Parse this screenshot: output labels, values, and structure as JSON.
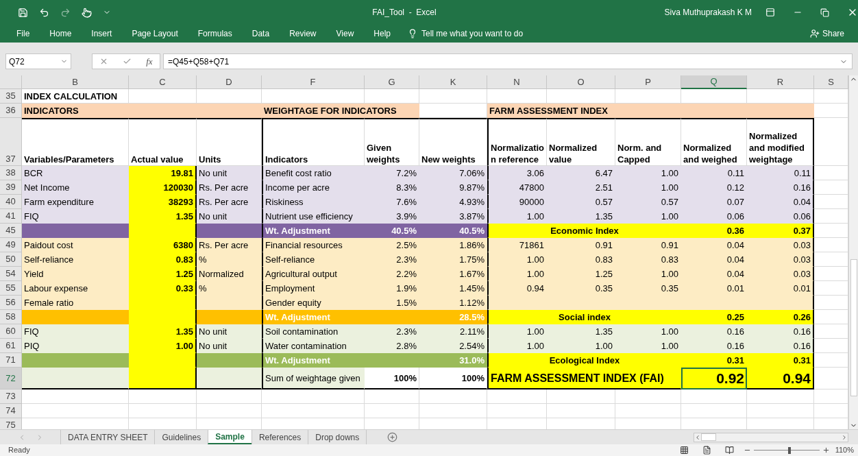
{
  "window": {
    "title": "FAI_Tool  -  Excel",
    "user": "Siva Muthuprakash K M"
  },
  "ribbon_tabs": [
    {
      "label": "File"
    },
    {
      "label": "Home"
    },
    {
      "label": "Insert"
    },
    {
      "label": "Page Layout"
    },
    {
      "label": "Formulas"
    },
    {
      "label": "Data"
    },
    {
      "label": "Review"
    },
    {
      "label": "View"
    },
    {
      "label": "Help"
    }
  ],
  "tell_me": "Tell me what you want to do",
  "share": "Share",
  "formula_bar": {
    "name_box": "Q72",
    "function_label": "fx",
    "formula": "=Q45+Q58+Q71"
  },
  "columns": [
    {
      "label": "B",
      "selected": false
    },
    {
      "label": "C",
      "selected": false
    },
    {
      "label": "D",
      "selected": false
    },
    {
      "label": "F",
      "selected": false
    },
    {
      "label": "G",
      "selected": false
    },
    {
      "label": "K",
      "selected": false
    },
    {
      "label": "N",
      "selected": false
    },
    {
      "label": "O",
      "selected": false
    },
    {
      "label": "P",
      "selected": false
    },
    {
      "label": "Q",
      "selected": true
    },
    {
      "label": "R",
      "selected": false
    },
    {
      "label": "S",
      "selected": false
    }
  ],
  "rows": [
    {
      "num": "35",
      "kind": "title",
      "selected": false,
      "cells": {
        "b": "INDEX CALCULATION"
      }
    },
    {
      "num": "36",
      "kind": "section_header",
      "selected": false,
      "cells": {
        "b": "INDICATORS",
        "f": "WEIGHTAGE FOR INDICATORS",
        "n": "FARM ASSESSMENT INDEX"
      }
    },
    {
      "num": "37",
      "kind": "column_header",
      "selected": false,
      "cells": {
        "b": "Variables/Parameters",
        "c": "Actual value",
        "d": "Units",
        "f": "Indicators",
        "g": "Given weights",
        "k": "New weights",
        "n": "Normalization reference",
        "o": "Normalized value",
        "p": "Norm. and Capped",
        "q": "Normalized and weighed",
        "r": "Normalized and modified weightage"
      }
    },
    {
      "num": "38",
      "kind": "economic",
      "selected": false,
      "cells": {
        "b": "BCR",
        "c": "19.81",
        "d": "No unit",
        "f": "Benefit cost ratio",
        "g": "7.2%",
        "k": "7.06%",
        "n": "3.06",
        "o": "6.47",
        "p": "1.00",
        "q": "0.11",
        "r": "0.11"
      }
    },
    {
      "num": "39",
      "kind": "economic",
      "selected": false,
      "cells": {
        "b": "Net Income",
        "c": "120030",
        "d": "Rs. Per acre",
        "f": "Income per acre",
        "g": "8.3%",
        "k": "9.87%",
        "n": "47800",
        "o": "2.51",
        "p": "1.00",
        "q": "0.12",
        "r": "0.16"
      }
    },
    {
      "num": "40",
      "kind": "economic",
      "selected": false,
      "cells": {
        "b": "Farm expenditure",
        "c": "38293",
        "d": "Rs. Per acre",
        "f": "Riskiness",
        "g": "7.6%",
        "k": "4.93%",
        "n": "90000",
        "o": "0.57",
        "p": "0.57",
        "q": "0.07",
        "r": "0.04"
      }
    },
    {
      "num": "41",
      "kind": "economic",
      "selected": false,
      "cells": {
        "b": "FIQ",
        "c": "1.35",
        "d": "No unit",
        "f": "Nutrient use efficiency",
        "g": "3.9%",
        "k": "3.87%",
        "n": "1.00",
        "o": "1.35",
        "p": "1.00",
        "q": "0.06",
        "r": "0.06"
      }
    },
    {
      "num": "45",
      "kind": "economic_total",
      "selected": false,
      "cells": {
        "f": "Wt. Adjustment",
        "g": "40.5%",
        "k": "40.5%",
        "n": "Economic Index",
        "q": "0.36",
        "r": "0.37"
      }
    },
    {
      "num": "49",
      "kind": "social",
      "selected": false,
      "cells": {
        "b": "Paidout cost",
        "c": "6380",
        "d": "Rs. Per acre",
        "f": "Financial resources",
        "g": "2.5%",
        "k": "1.86%",
        "n": "71861",
        "o": "0.91",
        "p": "0.91",
        "q": "0.04",
        "r": "0.03"
      }
    },
    {
      "num": "50",
      "kind": "social",
      "selected": false,
      "cells": {
        "b": "Self-reliance",
        "c": "0.83",
        "d": "%",
        "f": "Self-reliance",
        "g": "2.3%",
        "k": "1.75%",
        "n": "1.00",
        "o": "0.83",
        "p": "0.83",
        "q": "0.04",
        "r": "0.03"
      }
    },
    {
      "num": "54",
      "kind": "social",
      "selected": false,
      "cells": {
        "b": "Yield",
        "c": "1.25",
        "d": "Normalized",
        "f": "Agricultural output",
        "g": "2.2%",
        "k": "1.67%",
        "n": "1.00",
        "o": "1.25",
        "p": "1.00",
        "q": "0.04",
        "r": "0.03"
      }
    },
    {
      "num": "55",
      "kind": "social",
      "selected": false,
      "cells": {
        "b": "Labour expense",
        "c": "0.33",
        "d": "%",
        "f": "Employment",
        "g": "1.9%",
        "k": "1.45%",
        "n": "0.94",
        "o": "0.35",
        "p": "0.35",
        "q": "0.01",
        "r": "0.01"
      }
    },
    {
      "num": "56",
      "kind": "social",
      "selected": false,
      "cells": {
        "b": "Female ratio",
        "f": "Gender equity",
        "g": "1.5%",
        "k": "1.12%"
      }
    },
    {
      "num": "58",
      "kind": "social_total",
      "selected": false,
      "cells": {
        "f": "Wt. Adjustment",
        "k": "28.5%",
        "n": "Social index",
        "q": "0.25",
        "r": "0.26"
      }
    },
    {
      "num": "60",
      "kind": "ecological",
      "selected": false,
      "cells": {
        "b": "FIQ",
        "c": "1.35",
        "d": "No unit",
        "f": "Soil contamination",
        "g": "2.3%",
        "k": "2.11%",
        "n": "1.00",
        "o": "1.35",
        "p": "1.00",
        "q": "0.16",
        "r": "0.16"
      }
    },
    {
      "num": "61",
      "kind": "ecological",
      "selected": false,
      "cells": {
        "b": "PIQ",
        "c": "1.00",
        "d": "No unit",
        "f": "Water contamination",
        "g": "2.8%",
        "k": "2.54%",
        "n": "1.00",
        "o": "1.00",
        "p": "1.00",
        "q": "0.16",
        "r": "0.16"
      }
    },
    {
      "num": "71",
      "kind": "ecological_total",
      "selected": false,
      "cells": {
        "f": "Wt. Adjustment",
        "k": "31.0%",
        "n": "Ecological Index",
        "q": "0.31",
        "r": "0.31"
      }
    },
    {
      "num": "72",
      "kind": "fai",
      "selected": true,
      "cells": {
        "f": "Sum of weightage given",
        "g": "100%",
        "k": "100%",
        "n": "FARM ASSESSMENT INDEX (FAI)",
        "q": "0.92",
        "r": "0.94"
      }
    },
    {
      "num": "73",
      "kind": "empty",
      "selected": false,
      "cells": {}
    },
    {
      "num": "74",
      "kind": "empty",
      "selected": false,
      "cells": {}
    },
    {
      "num": "75",
      "kind": "empty",
      "selected": false,
      "cells": {}
    }
  ],
  "sheet_tabs": [
    {
      "label": "DATA ENTRY SHEET",
      "selected": false
    },
    {
      "label": "Guidelines",
      "selected": false
    },
    {
      "label": "Sample",
      "selected": true
    },
    {
      "label": "References",
      "selected": false
    },
    {
      "label": "Drop downs",
      "selected": false
    }
  ],
  "status": {
    "text": "Ready",
    "zoom": "110%",
    "zoom_slider": {
      "level": 0.55
    }
  }
}
